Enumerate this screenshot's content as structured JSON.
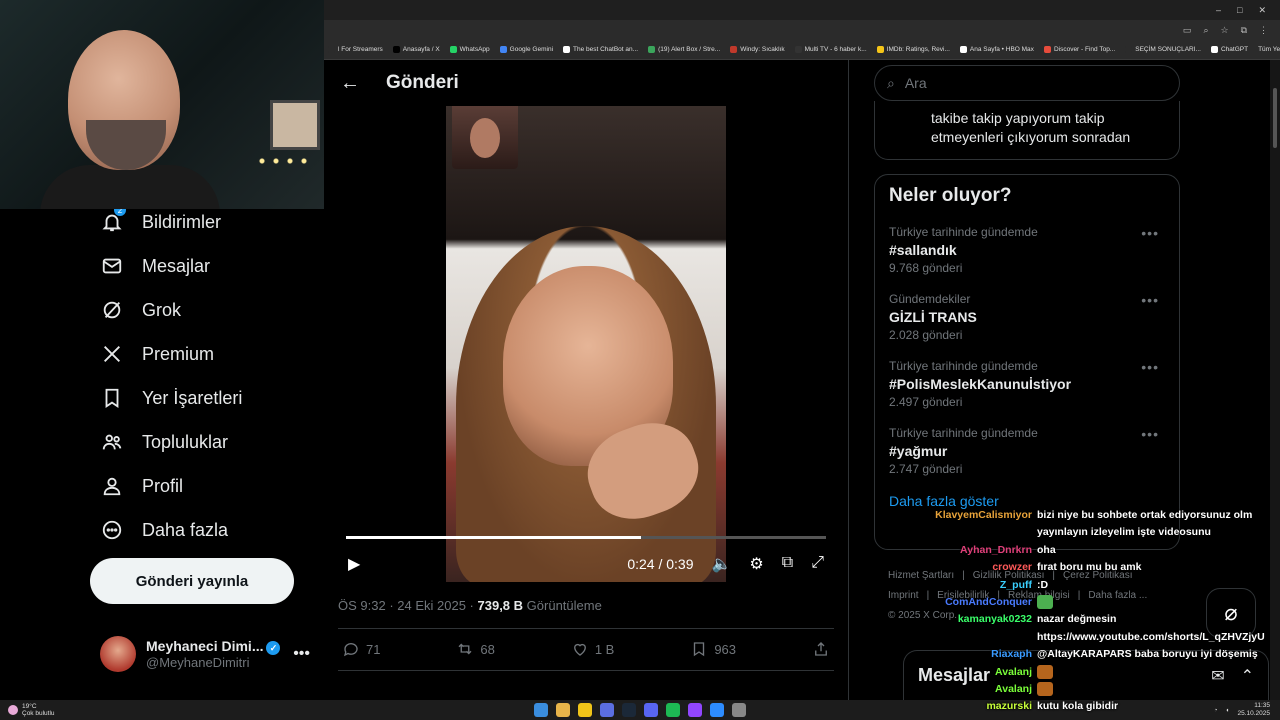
{
  "browser": {
    "window_controls": [
      "–",
      "□",
      "✕"
    ],
    "bookmarks": [
      {
        "label": "l For Streamers",
        "color": "#2b2b2b"
      },
      {
        "label": "Anasayfa / X",
        "color": "#000000"
      },
      {
        "label": "WhatsApp",
        "color": "#25d366"
      },
      {
        "label": "Google Gemini",
        "color": "#4285f4"
      },
      {
        "label": "The best ChatBot an...",
        "color": "#ffffff"
      },
      {
        "label": "(19) Alert Box / Stre...",
        "color": "#3ba55c"
      },
      {
        "label": "Windy: Sıcaklık",
        "color": "#c0392b"
      },
      {
        "label": "Multi TV - 6 haber k...",
        "color": "#333333"
      },
      {
        "label": "IMDb: Ratings, Revi...",
        "color": "#f5c518"
      },
      {
        "label": "Ana Sayfa • HBO Max",
        "color": "#ffffff"
      },
      {
        "label": "Discover - Find Top...",
        "color": "#e74c3c"
      },
      {
        "label": "SEÇİM SONUÇLARI...",
        "color": "#2b2b2b"
      },
      {
        "label": "ChatGPT",
        "color": "#ffffff"
      }
    ],
    "all_bookmarks": "Tüm Yer İşaretleri"
  },
  "nav": {
    "items": [
      {
        "label": "Bildirimler",
        "icon": "bell-icon",
        "badge": "2"
      },
      {
        "label": "Mesajlar",
        "icon": "mail-icon"
      },
      {
        "label": "Grok",
        "icon": "grok-icon"
      },
      {
        "label": "Premium",
        "icon": "x-logo-icon"
      },
      {
        "label": "Yer İşaretleri",
        "icon": "bookmark-icon"
      },
      {
        "label": "Topluluklar",
        "icon": "communities-icon"
      },
      {
        "label": "Profil",
        "icon": "profile-icon"
      },
      {
        "label": "Daha fazla",
        "icon": "more-circle-icon"
      }
    ],
    "post_button": "Gönderi yayınla",
    "account": {
      "name": "Meyhaneci Dimi...",
      "handle": "@MeyhaneDimitri"
    }
  },
  "main": {
    "title": "Gönderi",
    "video": {
      "current": "0:24",
      "duration": "0:39",
      "progress": 0.615
    },
    "meta": {
      "time": "ÖS 9:32",
      "date": "24 Eki 2025",
      "views": "739,8 B",
      "views_label": "Görüntüleme"
    },
    "actions": {
      "replies": "71",
      "reposts": "68",
      "likes": "1 B",
      "bookmarks": "963"
    }
  },
  "sidebar": {
    "search_placeholder": "Ara",
    "top_card_text": "takibe takip yapıyorum takip etmeyenleri çıkıyorum sonradan",
    "trends_title": "Neler oluyor?",
    "trends": [
      {
        "context": "Türkiye tarihinde gündemde",
        "name": "#sallandık",
        "count": "9.768 gönderi"
      },
      {
        "context": "Gündemdekiler",
        "name": "GİZLİ TRANS",
        "count": "2.028 gönderi"
      },
      {
        "context": "Türkiye tarihinde gündemde",
        "name": "#PolisMeslekKanunuİstiyor",
        "count": "2.497 gönderi"
      },
      {
        "context": "Türkiye tarihinde gündemde",
        "name": "#yağmur",
        "count": "2.747 gönderi"
      }
    ],
    "show_more": "Daha fazla göster",
    "footer_line1": [
      "Hizmet Şartları",
      "Gizlilik Politikası",
      "Çerez Politikası"
    ],
    "footer_line2": [
      "Imprint",
      "Erişilebilirlik",
      "Reklam bilgisi",
      "Daha fazla ..."
    ],
    "copyright": "© 2025 X Corp.",
    "messages_dock_title": "Mesajlar"
  },
  "chat": [
    {
      "user": "KlavyemCalismiyor",
      "color": "#e8a33a",
      "msg": "bizi niye bu sohbete ortak ediyorsunuz olm"
    },
    {
      "user": "",
      "color": "#ffffff",
      "msg": "yayınlayın izleyelim işte videosunu"
    },
    {
      "user": "Ayhan_Dnrkrn",
      "color": "#e0407a",
      "msg": "oha"
    },
    {
      "user": "crowzer",
      "color": "#ff5a5a",
      "msg": "fırat boru mu bu amk"
    },
    {
      "user": "Z_puff",
      "color": "#3ad0ff",
      "msg": ":D"
    },
    {
      "user": "ComAndConquer",
      "color": "#4a7bff",
      "msg": "",
      "emote": "#4caf50"
    },
    {
      "user": "kamanyak0232",
      "color": "#3aff6a",
      "msg": "nazar değmesin"
    },
    {
      "user": "",
      "color": "#ffffff",
      "msg": "https://www.youtube.com/shorts/L_qZHVZjyU"
    },
    {
      "user": "Riaxaph",
      "color": "#3a9bff",
      "msg": "@AltayKARAPARS baba boruyu iyi döşemiş"
    },
    {
      "user": "Avalanj",
      "color": "#7bff3a",
      "msg": "",
      "emote": "#b5651d"
    },
    {
      "user": "Avalanj",
      "color": "#7bff3a",
      "msg": "",
      "emote": "#b5651d"
    },
    {
      "user": "mazurski",
      "color": "#c8ff3a",
      "msg": "kutu kola gibidir"
    }
  ],
  "taskbar": {
    "weather_temp": "19°C",
    "weather_desc": "Çok bulutlu",
    "time": "11:35",
    "date": "25.10.2025"
  }
}
